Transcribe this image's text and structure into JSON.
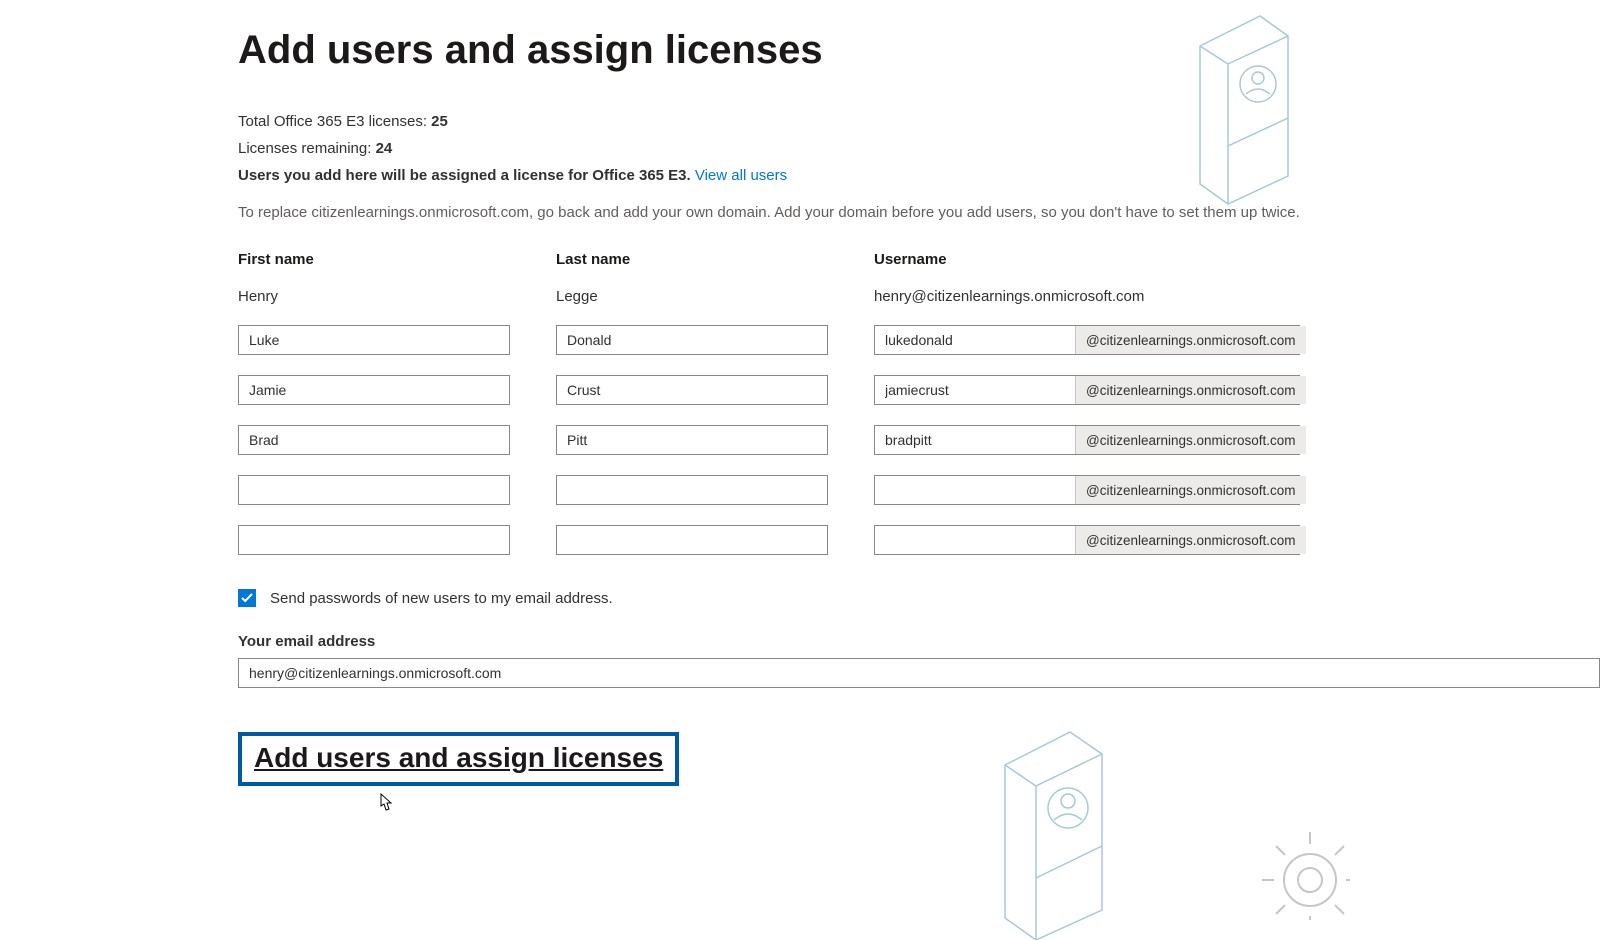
{
  "page": {
    "title": "Add users and assign licenses",
    "total_label": "Total Office 365 E3 licenses: ",
    "total_value": "25",
    "remaining_label": "Licenses remaining: ",
    "remaining_value": "24",
    "assign_text": "Users you add here will be assigned a license for Office 365 E3. ",
    "view_all_link": "View all users",
    "replace_note": "To replace citizenlearnings.onmicrosoft.com, go back and add your own domain. Add your domain before you add users, so you don't have to set them up twice."
  },
  "columns": {
    "first": "First name",
    "last": "Last name",
    "user": "Username"
  },
  "existing": {
    "first": "Henry",
    "last": "Legge",
    "username": "henry@citizenlearnings.onmicrosoft.com"
  },
  "domain_suffix": "@citizenlearnings.onmicrosoft.com",
  "rows": [
    {
      "first": "Luke",
      "last": "Donald",
      "uname": "lukedonald"
    },
    {
      "first": "Jamie",
      "last": "Crust",
      "uname": "jamiecrust"
    },
    {
      "first": "Brad",
      "last": "Pitt",
      "uname": "bradpitt"
    },
    {
      "first": "",
      "last": "",
      "uname": ""
    },
    {
      "first": "",
      "last": "",
      "uname": ""
    }
  ],
  "send_pw": {
    "checked": true,
    "label": "Send passwords of new users to my email address."
  },
  "email": {
    "label": "Your email address",
    "value": "henry@citizenlearnings.onmicrosoft.com"
  },
  "cta": {
    "label": "Add users and assign licenses"
  }
}
